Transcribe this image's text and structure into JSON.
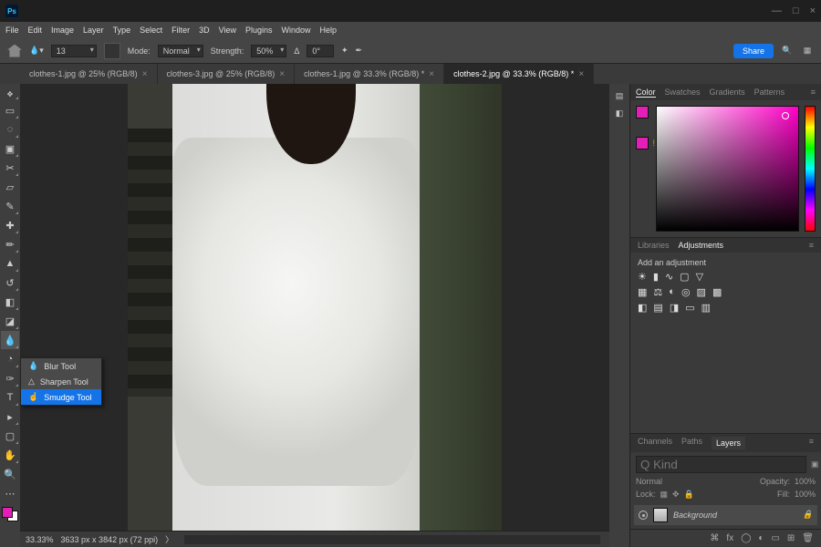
{
  "title": {
    "app": "Ps"
  },
  "window_controls": {
    "min": "—",
    "max": "□",
    "close": "×"
  },
  "menubar": [
    "File",
    "Edit",
    "Image",
    "Layer",
    "Type",
    "Select",
    "Filter",
    "3D",
    "View",
    "Plugins",
    "Window",
    "Help"
  ],
  "optbar": {
    "brush_size": "13",
    "mode_label": "Mode:",
    "mode_value": "Normal",
    "strength_label": "Strength:",
    "strength_value": "50%",
    "angle_label": "Δ",
    "angle_value": "0°",
    "share": "Share"
  },
  "tabs": [
    {
      "label": "clothes-1.jpg @ 25% (RGB/8)",
      "active": false
    },
    {
      "label": "clothes-3.jpg @ 25% (RGB/8)",
      "active": false
    },
    {
      "label": "clothes-1.jpg @ 33.3% (RGB/8) *",
      "active": false
    },
    {
      "label": "clothes-2.jpg @ 33.3% (RGB/8) *",
      "active": true
    }
  ],
  "flyout": [
    {
      "label": "Blur Tool"
    },
    {
      "label": "Sharpen Tool"
    },
    {
      "label": "Smudge Tool",
      "selected": true
    }
  ],
  "status": {
    "zoom": "33.33%",
    "info": "3633 px x 3842 px (72 ppi)"
  },
  "color_panel": {
    "tabs": [
      "Color",
      "Swatches",
      "Gradients",
      "Patterns"
    ],
    "active": "Color",
    "foreground": "#e61eb8",
    "background": "#ffffff"
  },
  "libs": {
    "tabs": [
      "Libraries",
      "Adjustments"
    ],
    "active": "Adjustments",
    "text": "Add an adjustment"
  },
  "layers_panel": {
    "tabs": [
      "Channels",
      "Paths",
      "Layers"
    ],
    "active": "Layers",
    "kind_placeholder": "Q Kind",
    "blend": "Normal",
    "opacity_label": "Opacity:",
    "opacity": "100%",
    "lock_label": "Lock:",
    "fill_label": "Fill:",
    "fill": "100%",
    "layers": [
      {
        "name": "Background",
        "locked": true
      }
    ]
  }
}
